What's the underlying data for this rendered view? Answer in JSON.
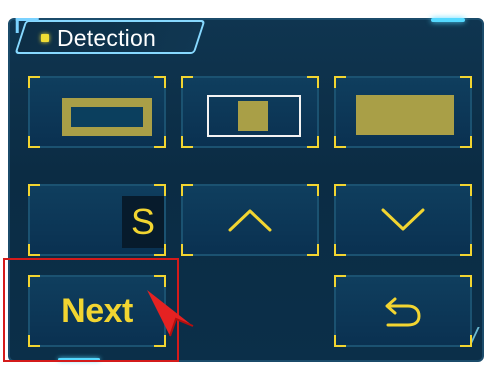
{
  "header": {
    "title": "Detection"
  },
  "buttons": {
    "row1": [
      {
        "shape": "rectangle-border"
      },
      {
        "shape": "outlined-rectangle-with-square"
      },
      {
        "shape": "filled-rectangle"
      }
    ],
    "row2": [
      {
        "label": "S"
      },
      {
        "icon": "chevron-up-icon"
      },
      {
        "icon": "chevron-down-icon"
      }
    ],
    "row3": [
      {
        "label": "Next"
      },
      {
        "icon": "back-arrow-icon"
      }
    ]
  },
  "colors": {
    "panel": "#0b2f49",
    "accent": "#f2d531",
    "cyan": "#55d9ff",
    "highlight": "#d41b1b"
  }
}
